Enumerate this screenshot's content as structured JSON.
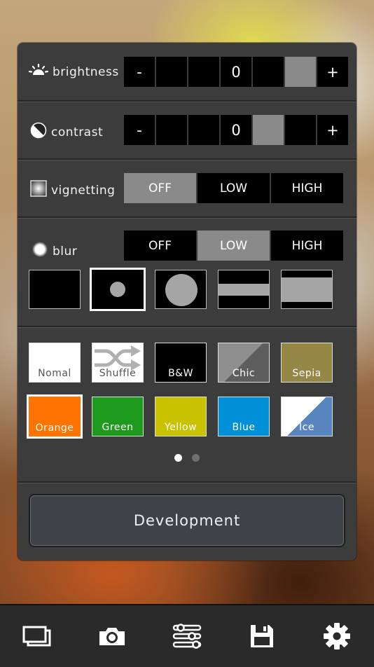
{
  "brightness": {
    "label": "brightness",
    "minus": "-",
    "plus": "+",
    "value": "0",
    "selected_cell": 5
  },
  "contrast": {
    "label": "contrast",
    "minus": "-",
    "plus": "+",
    "value": "0",
    "selected_cell": 4
  },
  "vignetting": {
    "label": "vignetting",
    "options": [
      "OFF",
      "LOW",
      "HIGH"
    ],
    "selected": "OFF"
  },
  "blur": {
    "label": "blur",
    "options": [
      "OFF",
      "LOW",
      "HIGH"
    ],
    "selected": "LOW",
    "shapes": [
      "none",
      "small-circle",
      "large-circle",
      "thin-band",
      "wide-band"
    ],
    "selected_shape": "small-circle"
  },
  "filters": {
    "row1": [
      {
        "label": "Nomal",
        "bg": "#ffffff",
        "fg": "#555555"
      },
      {
        "label": "Shuffle",
        "bg": "#ffffff",
        "fg": "#555555"
      },
      {
        "label": "B&W",
        "bg": "#000000",
        "fg": "#ffffff"
      },
      {
        "label": "Chic",
        "bg": "#8a8a8a",
        "fg": "#ffffff"
      },
      {
        "label": "Sepia",
        "bg": "#958745",
        "fg": "#ffffff"
      }
    ],
    "row2": [
      {
        "label": "Orange",
        "bg": "#ff7300",
        "fg": "#ffffff"
      },
      {
        "label": "Green",
        "bg": "#1e9a1e",
        "fg": "#ffffff"
      },
      {
        "label": "Yellow",
        "bg": "#c8c200",
        "fg": "#ffffff"
      },
      {
        "label": "Blue",
        "bg": "#0090d8",
        "fg": "#ffffff"
      },
      {
        "label": "Ice",
        "bg": "#5a86c0",
        "fg": "#ffffff"
      }
    ],
    "selected": "Orange"
  },
  "pager": {
    "pages": 2,
    "current": 1
  },
  "development_button": "Development",
  "tabbar": {
    "icons": [
      "gallery-icon",
      "camera-icon",
      "sliders-icon",
      "save-icon",
      "gear-icon"
    ]
  }
}
